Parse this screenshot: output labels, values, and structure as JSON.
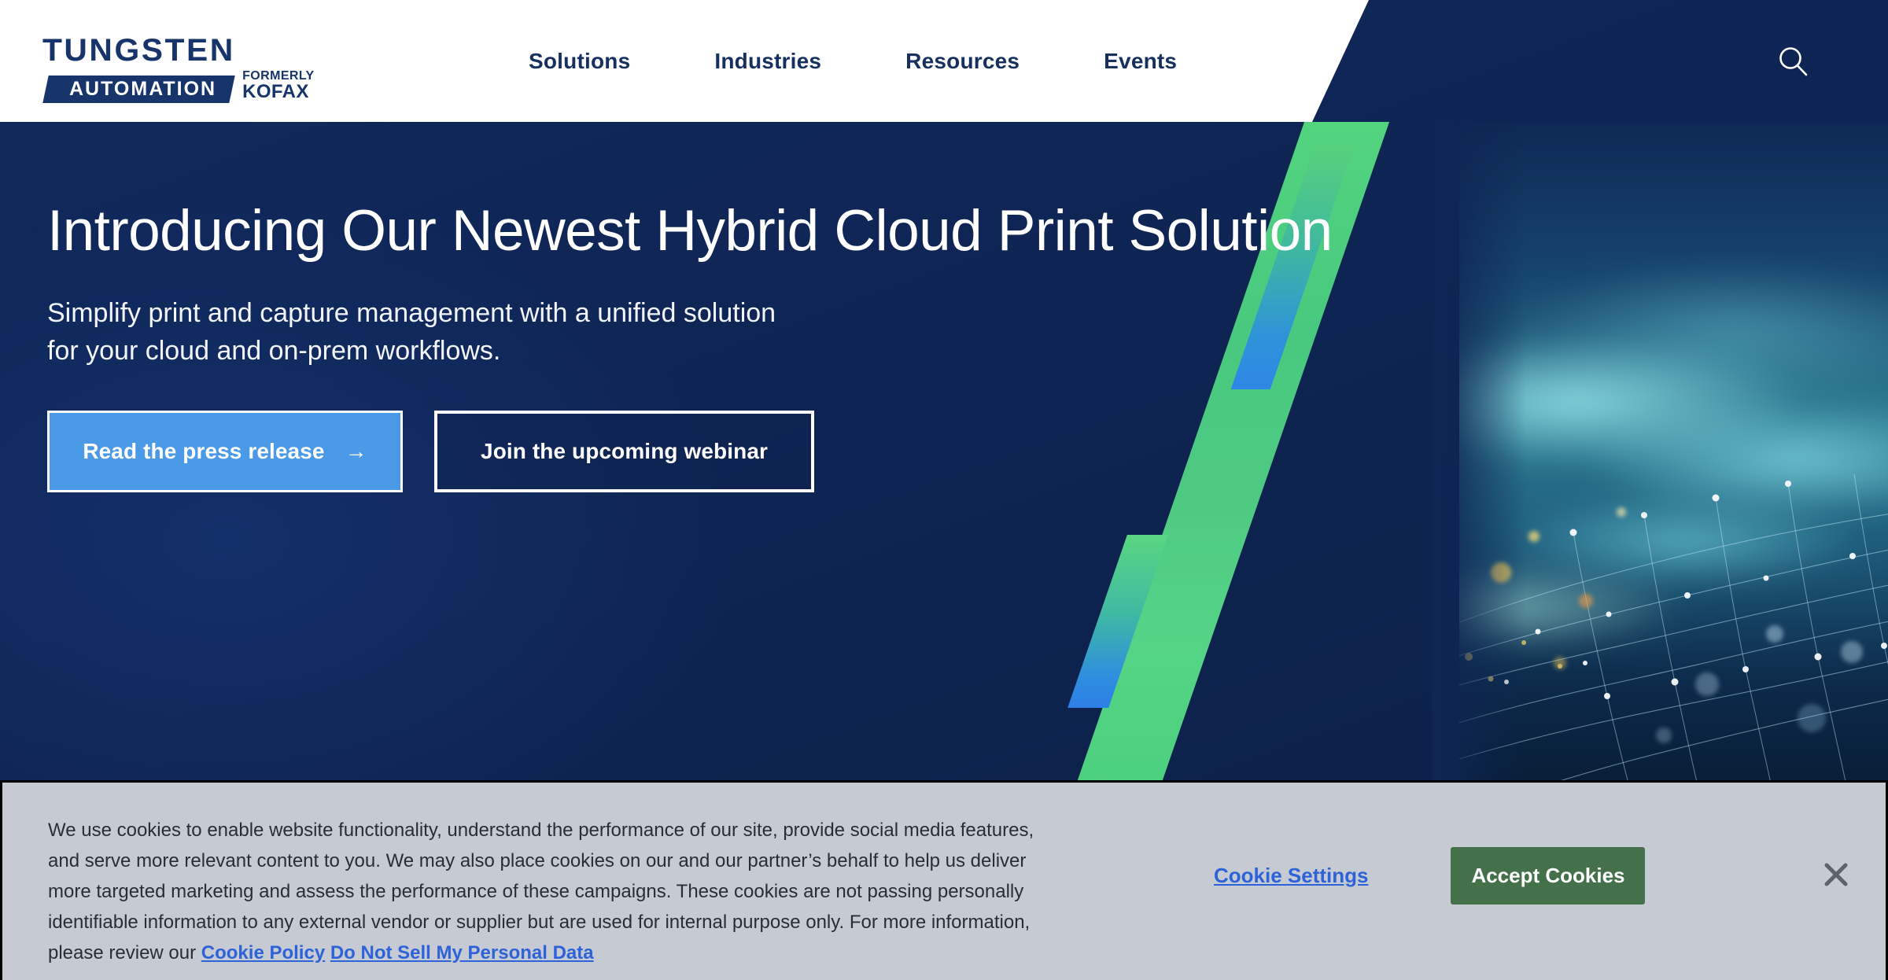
{
  "header": {
    "logo": {
      "wordmark": "TUNGSTEN",
      "badge": "AUTOMATION",
      "formerly_line1": "FORMERLY",
      "formerly_line2": "KOFAX"
    },
    "nav_items": [
      {
        "label": "Solutions"
      },
      {
        "label": "Industries"
      },
      {
        "label": "Resources"
      },
      {
        "label": "Events"
      }
    ],
    "search_icon": "search-icon"
  },
  "hero": {
    "headline": "Introducing Our Newest Hybrid Cloud Print Solution",
    "subhead_line1": "Simplify print and capture management with a unified solution",
    "subhead_line2": "for your cloud and on-prem workflows.",
    "primary_cta": "Read the press release",
    "primary_cta_arrow": "→",
    "secondary_cta": "Join the upcoming webinar"
  },
  "cookie_banner": {
    "body_line1": "We use cookies to enable website functionality, understand the performance of our site, provide social media features,",
    "body_line2": "and serve more relevant content to you. We may also place cookies on our and our partner’s behalf to help us deliver",
    "body_line3": "more targeted marketing and assess the performance of these campaigns. These cookies are not passing personally",
    "body_line4": "identifiable information to any external vendor or supplier but are used for internal purpose only. For more information,",
    "body_line5_prefix": "please review our",
    "link_cookie_policy": "Cookie Policy",
    "link_do_not_sell": "Do Not Sell My Personal Data",
    "settings_label": "Cookie Settings",
    "accept_label": "Accept Cookies",
    "close_icon": "close-icon"
  },
  "colors": {
    "navy": "#0f2553",
    "logo_navy": "#17356a",
    "primary_button": "#4b9ae8",
    "accept_green": "#44704a",
    "link_blue": "#2d62d8",
    "banner_gray": "#c6cbd3",
    "stripe_green": "#4ec983",
    "stripe_blue": "#2f86e6"
  }
}
